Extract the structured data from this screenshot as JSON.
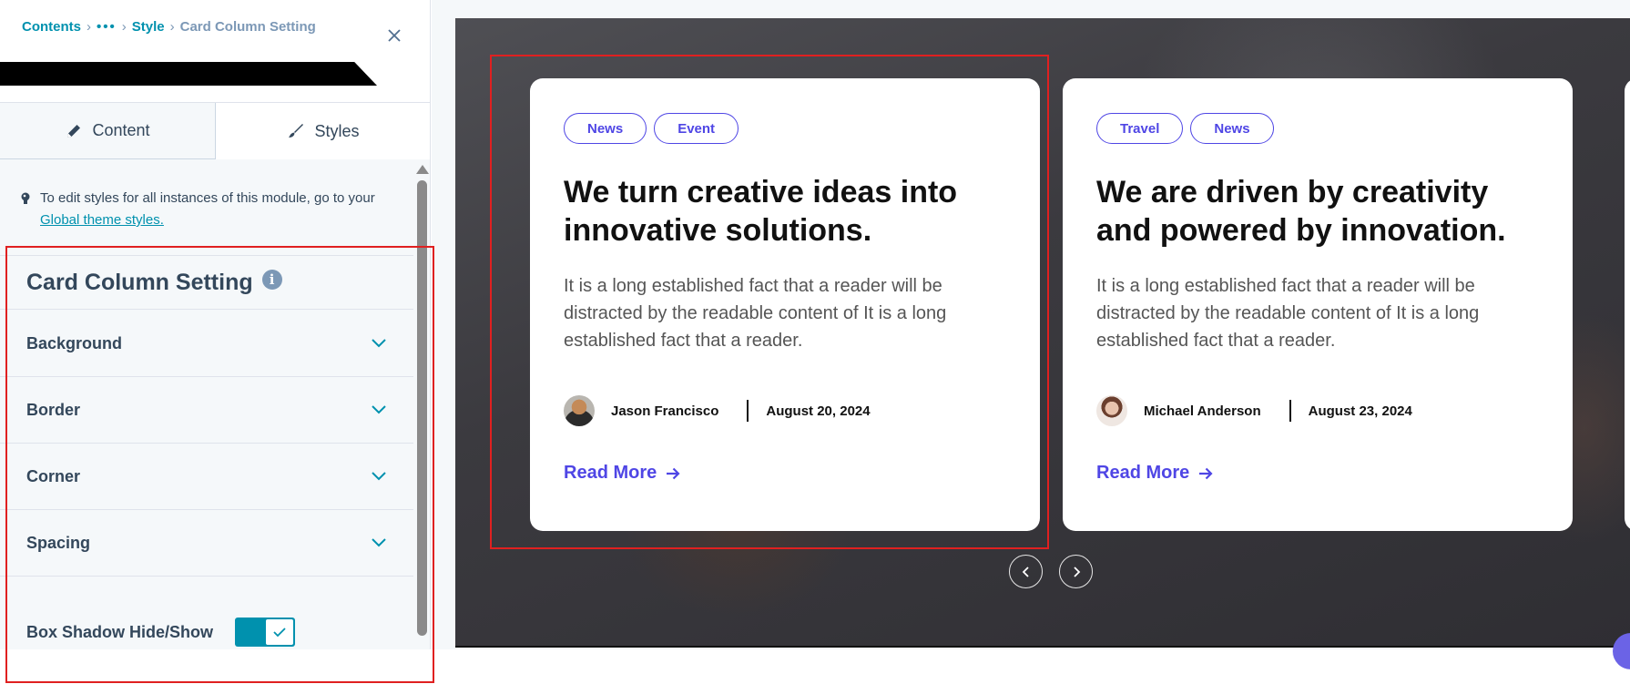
{
  "breadcrumb": {
    "contents": "Contents",
    "ellipsis": "•••",
    "style": "Style",
    "current": "Card Column Setting"
  },
  "tabs": {
    "content": "Content",
    "styles": "Styles"
  },
  "note": {
    "text_before": "To edit styles for all instances of this module, go to your ",
    "link": "Global theme styles."
  },
  "section": {
    "title": "Card Column Setting"
  },
  "accordion": [
    "Background",
    "Border",
    "Corner",
    "Spacing"
  ],
  "box_shadow": {
    "label": "Box Shadow Hide/Show",
    "enabled": true
  },
  "cards": [
    {
      "tags": [
        "News",
        "Event"
      ],
      "title": "We turn creative ideas into innovative solutions.",
      "body": "It is a long established fact that a reader will be distracted by the readable content of It is a long established fact that a reader.",
      "author": "Jason Francisco",
      "date": "August 20, 2024",
      "cta": "Read More"
    },
    {
      "tags": [
        "Travel",
        "News"
      ],
      "title": "We are driven by creativity and powered by innovation.",
      "body": "It is a long established fact that a reader will be distracted by the readable content of It is a long established fact that a reader.",
      "author": "Michael Anderson",
      "date": "August 23, 2024",
      "cta": "Read More"
    }
  ],
  "colors": {
    "brand_teal": "#0091ae",
    "accent_indigo": "#4f46e5",
    "highlight_red": "#e02020",
    "text_dark": "#33475b"
  }
}
